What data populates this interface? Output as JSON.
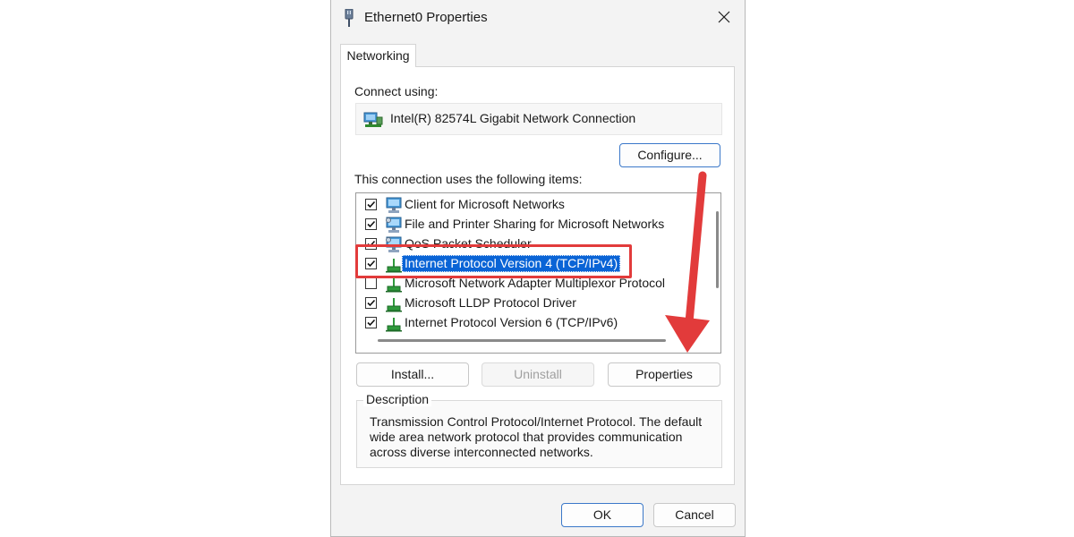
{
  "window": {
    "title": "Ethernet0 Properties",
    "close_symbol": "✕"
  },
  "tabs": [
    {
      "label": "Networking",
      "active": true
    }
  ],
  "connect_using": {
    "label": "Connect using:",
    "adapter_name": "Intel(R) 82574L Gigabit Network Connection",
    "adapter_icon": "network-adapter-icon"
  },
  "buttons": {
    "configure": "Configure...",
    "install": "Install...",
    "uninstall": "Uninstall",
    "properties": "Properties",
    "ok": "OK",
    "cancel": "Cancel"
  },
  "items_label": "This connection uses the following items:",
  "items": [
    {
      "label": "Client for Microsoft Networks",
      "checked": true,
      "icon": "network-client-icon",
      "selected": false
    },
    {
      "label": "File and Printer Sharing for Microsoft Networks",
      "checked": true,
      "icon": "network-service-icon",
      "selected": false
    },
    {
      "label": "QoS Packet Scheduler",
      "checked": true,
      "icon": "network-service-icon",
      "selected": false
    },
    {
      "label": "Internet Protocol Version 4 (TCP/IPv4)",
      "checked": true,
      "icon": "network-protocol-icon",
      "selected": true
    },
    {
      "label": "Microsoft Network Adapter Multiplexor Protocol",
      "checked": false,
      "icon": "network-protocol-icon",
      "selected": false
    },
    {
      "label": "Microsoft LLDP Protocol Driver",
      "checked": true,
      "icon": "network-protocol-icon",
      "selected": false
    },
    {
      "label": "Internet Protocol Version 6 (TCP/IPv6)",
      "checked": true,
      "icon": "network-protocol-icon",
      "selected": false
    }
  ],
  "description": {
    "legend": "Description",
    "text": "Transmission Control Protocol/Internet Protocol. The default wide area network protocol that provides communication across diverse interconnected networks."
  },
  "colors": {
    "selection": "#0a64d6",
    "annotation": "#e23b3b",
    "primary_border": "#3b78c9"
  }
}
